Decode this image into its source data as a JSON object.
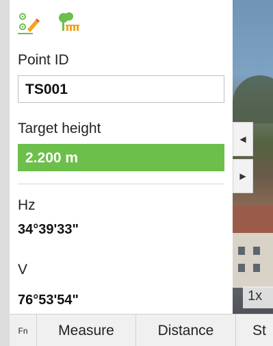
{
  "toolbar": {
    "icons": [
      "points-edit-icon",
      "target-prism-icon"
    ]
  },
  "point_id": {
    "label": "Point ID",
    "value": "TS001"
  },
  "target_height": {
    "label": "Target height",
    "value": "2.200 m"
  },
  "hz": {
    "label": "Hz",
    "value": "34°39'33\""
  },
  "v": {
    "label": "V",
    "value": "76°53'54\""
  },
  "camera": {
    "zoom_label": "1x",
    "nav_left_icon": "triangle-left-icon",
    "nav_right_icon": "triangle-right-icon"
  },
  "bottom_bar": {
    "fn_label": "Fn",
    "measure_label": "Measure",
    "distance_label": "Distance",
    "more_label": "St"
  },
  "colors": {
    "accent_green": "#6cbf4a",
    "panel_bg": "#ffffff"
  }
}
